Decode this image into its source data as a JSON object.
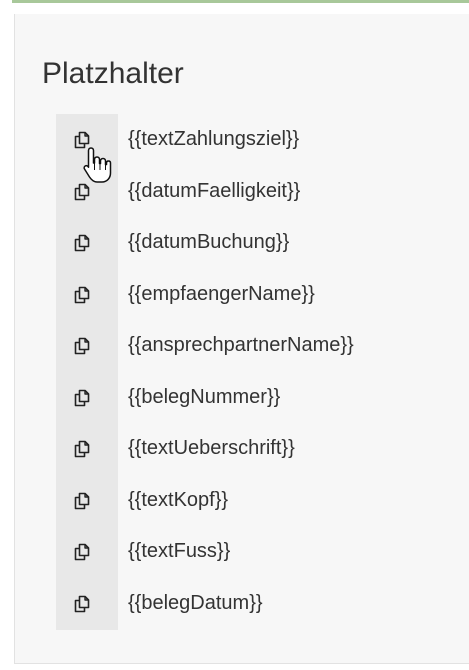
{
  "panel": {
    "title": "Platzhalter"
  },
  "placeholders": [
    {
      "label": "{{textZahlungsziel}}"
    },
    {
      "label": "{{datumFaelligkeit}}"
    },
    {
      "label": "{{datumBuchung}}"
    },
    {
      "label": "{{empfaengerName}}"
    },
    {
      "label": "{{ansprechpartnerName}}"
    },
    {
      "label": "{{belegNummer}}"
    },
    {
      "label": "{{textUeberschrift}}"
    },
    {
      "label": "{{textKopf}}"
    },
    {
      "label": "{{textFuss}}"
    },
    {
      "label": "{{belegDatum}}"
    }
  ],
  "icons": {
    "copy": "copy-icon",
    "cursor": "hand-pointer-cursor"
  },
  "colors": {
    "accent_rule": "#a8c89a",
    "panel_bg": "#f7f7f7",
    "icon_column_bg": "#e8e8e8",
    "text": "#333333"
  }
}
